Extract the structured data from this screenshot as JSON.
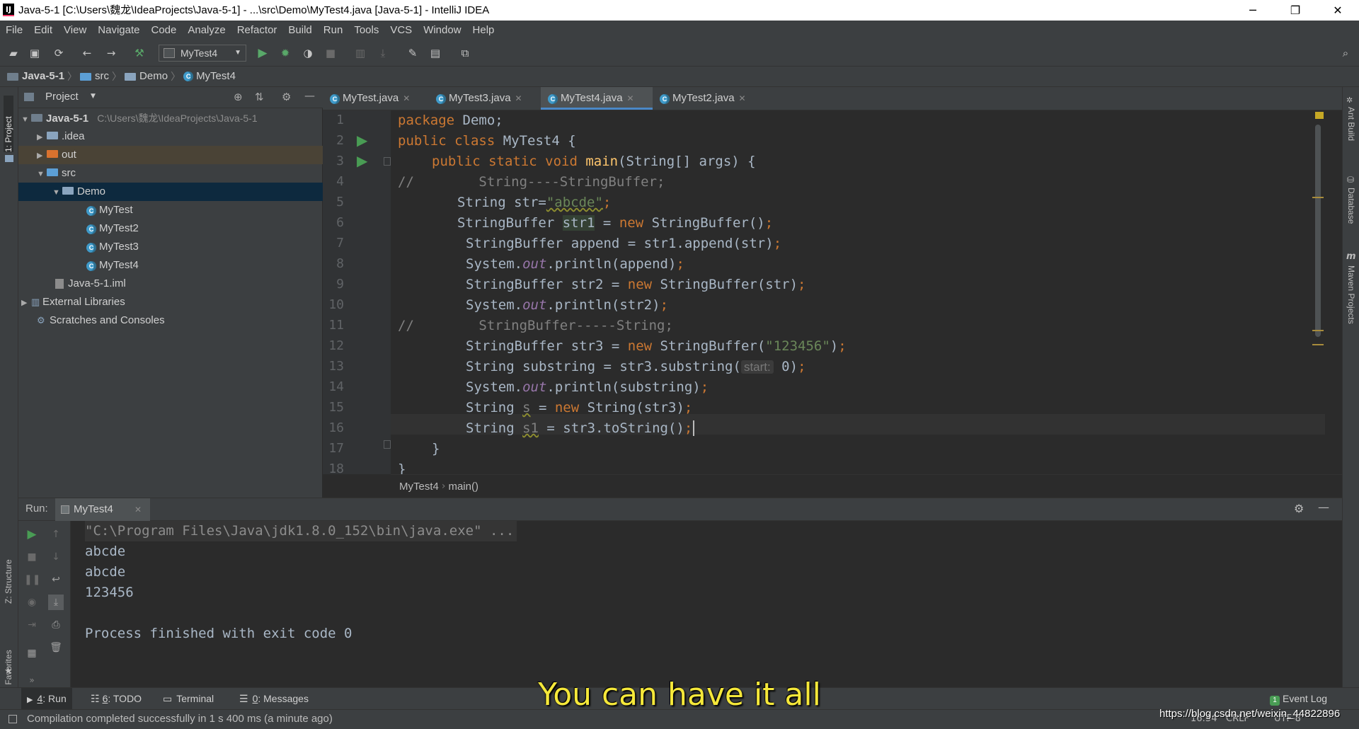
{
  "window": {
    "title": "Java-5-1 [C:\\Users\\魏龙\\IdeaProjects\\Java-5-1] - ...\\src\\Demo\\MyTest4.java [Java-5-1] - IntelliJ IDEA",
    "minimize": "─",
    "restore": "❐",
    "close": "✕"
  },
  "menu": [
    "File",
    "Edit",
    "View",
    "Navigate",
    "Code",
    "Analyze",
    "Refactor",
    "Build",
    "Run",
    "Tools",
    "VCS",
    "Window",
    "Help"
  ],
  "toolbar": {
    "run_config": "MyTest4"
  },
  "breadcrumb": [
    "Java-5-1",
    "src",
    "Demo",
    "MyTest4"
  ],
  "left_strip": {
    "project_tab": "1: Project",
    "structure_tab": "Z: Structure",
    "favorites_tab": "2: Favorites"
  },
  "right_strip": {
    "ant_build": "Ant Build",
    "database": "Database",
    "maven": "Maven Projects",
    "maven_mark": "m"
  },
  "project": {
    "header": "Project",
    "root_name": "Java-5-1",
    "root_path": "C:\\Users\\魏龙\\IdeaProjects\\Java-5-1",
    "idea": ".idea",
    "out": "out",
    "src": "src",
    "demo": "Demo",
    "files": [
      "MyTest",
      "MyTest2",
      "MyTest3",
      "MyTest4"
    ],
    "iml": "Java-5-1.iml",
    "external": "External Libraries",
    "scratches": "Scratches and Consoles"
  },
  "tabs": [
    {
      "label": "MyTest.java"
    },
    {
      "label": "MyTest3.java"
    },
    {
      "label": "MyTest4.java"
    },
    {
      "label": "MyTest2.java"
    }
  ],
  "line_numbers": [
    "1",
    "2",
    "3",
    "4",
    "5",
    "6",
    "7",
    "8",
    "9",
    "10",
    "11",
    "12",
    "13",
    "14",
    "15",
    "16",
    "17",
    "18"
  ],
  "code": {
    "l1_kw": "package",
    "l1_rest": " Demo;",
    "l2_kw": "public class",
    "l2_rest": " MyTest4 {",
    "l3_kw": "public static void",
    "l3_m": " main",
    "l3_rest": "(String[] args) {",
    "l4": "//        String----StringBuffer;",
    "l5_a": "String str=",
    "l5_s": "\"abcde\"",
    "l5_e": ";",
    "l6_a": "StringBuffer ",
    "l6_v": "str1",
    "l6_b": " = ",
    "l6_kw": "new",
    "l6_c": " StringBuffer()",
    "l6_e": ";",
    "l7_a": "StringBuffer append = str1.append(str)",
    "l7_e": ";",
    "l8_a": "System.",
    "l8_f": "out",
    "l8_b": ".println(append)",
    "l8_e": ";",
    "l9_a": "StringBuffer str2 = ",
    "l9_kw": "new",
    "l9_b": " StringBuffer(str)",
    "l9_e": ";",
    "l10_a": "System.",
    "l10_f": "out",
    "l10_b": ".println(str2)",
    "l10_e": ";",
    "l11": "//        StringBuffer-----String;",
    "l12_a": "StringBuffer str3 = ",
    "l12_kw": "new",
    "l12_b": " StringBuffer(",
    "l12_s": "\"123456\"",
    "l12_c": ")",
    "l12_e": ";",
    "l13_a": "String substring = str3.substring(",
    "l13_hint": "start:",
    "l13_b": " 0)",
    "l13_e": ";",
    "l14_a": "System.",
    "l14_f": "out",
    "l14_b": ".println(substring)",
    "l14_e": ";",
    "l15_a": "String ",
    "l15_v": "s",
    "l15_b": " = ",
    "l15_kw": "new",
    "l15_c": " String(str3)",
    "l15_e": ";",
    "l16_a": "String ",
    "l16_v": "s1",
    "l16_b": " = str3.toString()",
    "l16_e": ";",
    "l17": "}",
    "l18": "}"
  },
  "editor_breadcrumb": [
    "MyTest4",
    "main()"
  ],
  "run": {
    "label": "Run:",
    "tab": "MyTest4",
    "output": [
      "\"C:\\Program Files\\Java\\jdk1.8.0_152\\bin\\java.exe\" ...",
      "abcde",
      "abcde",
      "123456",
      "",
      "Process finished with exit code 0"
    ]
  },
  "bottom_tabs": {
    "run_num": "4",
    "run": ": Run",
    "todo_num": "6",
    "todo": ": TODO",
    "terminal": "Terminal",
    "messages_num": "0",
    "messages": ": Messages",
    "event_badge": "1",
    "event_log": "Event Log"
  },
  "status": {
    "message": "Compilation completed successfully in 1 s 400 ms (a minute ago)",
    "position": "16:34",
    "line_sep": "CRLF",
    "encoding": "UTF-8"
  },
  "overlay": {
    "subtitle": "You can have it all",
    "watermark": "https://blog.csdn.net/weixin_44822896"
  }
}
